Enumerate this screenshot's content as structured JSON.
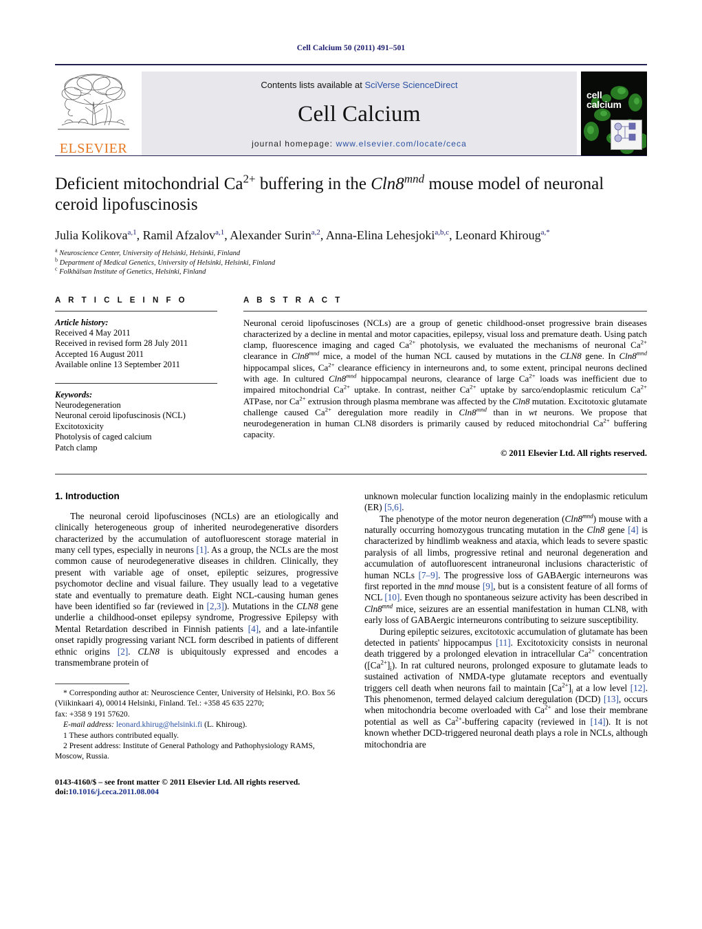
{
  "running_head": "Cell Calcium 50 (2011) 491–501",
  "banner": {
    "publisher": "ELSEVIER",
    "contents_prefix": "Contents lists available at ",
    "contents_link": "SciVerse ScienceDirect",
    "journal_name": "Cell Calcium",
    "homepage_prefix": "journal homepage:",
    "homepage_url": "www.elsevier.com/locate/ceca",
    "cover_title_line1": "cell",
    "cover_title_line2": "calcium"
  },
  "article": {
    "title_part1": "Deficient mitochondrial Ca",
    "title_sup1": "2+",
    "title_part2": " buffering in the ",
    "title_gene": "Cln8",
    "title_gene_sup": "mnd",
    "title_part3": " mouse model of neuronal ceroid lipofuscinosis",
    "authors": [
      {
        "name": "Julia Kolikova",
        "sup": "a,1"
      },
      {
        "name": "Ramil Afzalov",
        "sup": "a,1"
      },
      {
        "name": "Alexander Surin",
        "sup": "a,2"
      },
      {
        "name": "Anna-Elina Lehesjoki",
        "sup": "a,b,c"
      },
      {
        "name": "Leonard Khiroug",
        "sup": "a,*"
      }
    ],
    "affiliations": [
      {
        "mark": "a",
        "text": "Neuroscience Center, University of Helsinki, Helsinki, Finland"
      },
      {
        "mark": "b",
        "text": "Department of Medical Genetics, University of Helsinki, Helsinki, Finland"
      },
      {
        "mark": "c",
        "text": "Folkhälsan Institute of Genetics, Helsinki, Finland"
      }
    ]
  },
  "article_info": {
    "heading": "A R T I C L E   I N F O",
    "history_label": "Article history:",
    "history": [
      "Received 4 May 2011",
      "Received in revised form 28 July 2011",
      "Accepted 16 August 2011",
      "Available online 13 September 2011"
    ],
    "keywords_label": "Keywords:",
    "keywords": [
      "Neurodegeneration",
      "Neuronal ceroid lipofuscinosis (NCL)",
      "Excitotoxicity",
      "Photolysis of caged calcium",
      "Patch clamp"
    ]
  },
  "abstract": {
    "heading": "A B S T R A C T",
    "copyright": "© 2011 Elsevier Ltd. All rights reserved."
  },
  "introduction": {
    "heading": "1.  Introduction"
  },
  "footnotes": {
    "corresponding": "* Corresponding author at: Neuroscience Center, University of Helsinki, P.O. Box 56 (Viikinkaari 4), 00014 Helsinki, Finland. Tel.: +358 45 635 2270;",
    "fax": "fax: +358 9 191 57620.",
    "email_label": "E-mail address:",
    "email": "leonard.khirug@helsinki.fi",
    "email_suffix": "(L. Khiroug).",
    "note1": "1  These authors contributed equally.",
    "note2": "2  Present address: Institute of General Pathology and Pathophysiology RAMS, Moscow, Russia.",
    "issn_line": "0143-4160/$ – see front matter © 2011 Elsevier Ltd. All rights reserved.",
    "doi_label": "doi:",
    "doi": "10.1016/j.ceca.2011.08.004"
  }
}
